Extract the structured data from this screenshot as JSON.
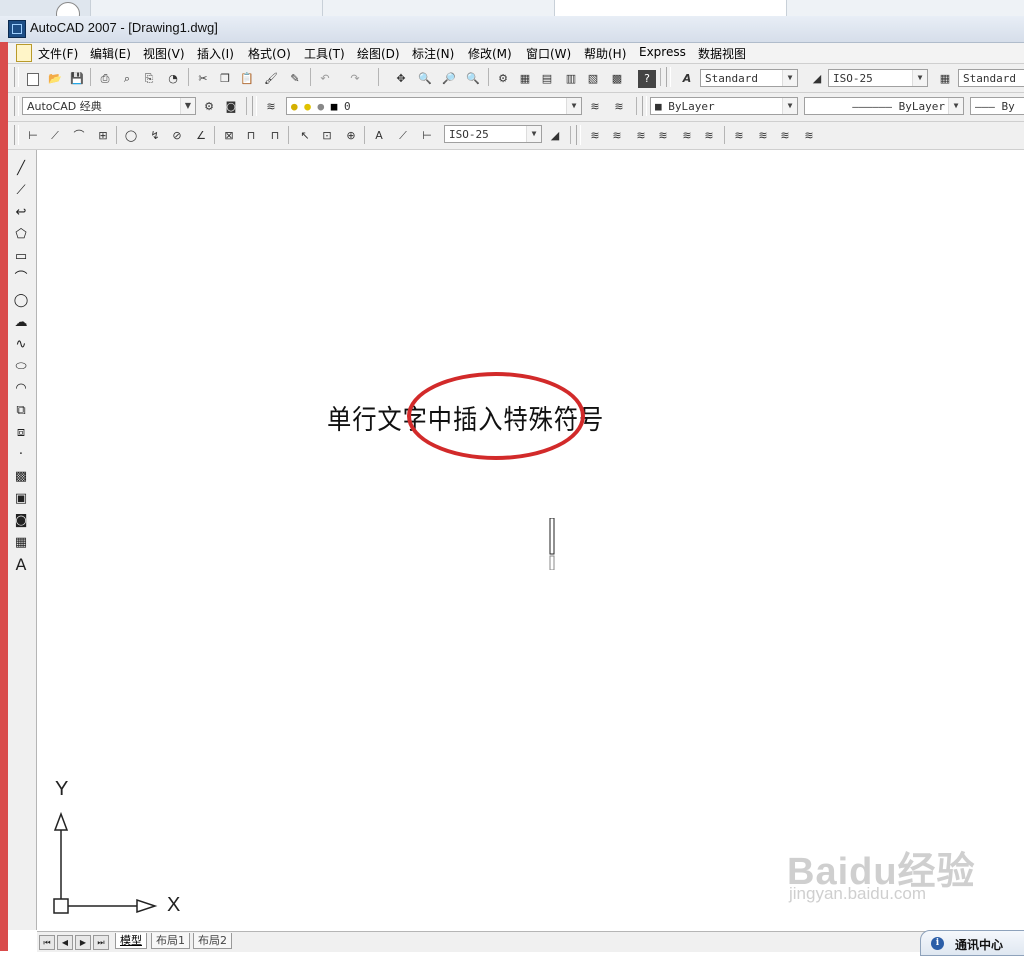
{
  "window": {
    "title": "AutoCAD 2007 - [Drawing1.dwg]"
  },
  "menu": {
    "items": [
      "文件(F)",
      "编辑(E)",
      "视图(V)",
      "插入(I)",
      "格式(O)",
      "工具(T)",
      "绘图(D)",
      "标注(N)",
      "修改(M)",
      "窗口(W)",
      "帮助(H)",
      "Express",
      "数据视图"
    ]
  },
  "toolbars": {
    "text_style": "Standard",
    "dim_style": "ISO-25",
    "table_style": "Standard",
    "workspace": "AutoCAD 经典",
    "layer": "0",
    "color": "ByLayer",
    "linetype": "ByLayer",
    "lineweight": "By",
    "dim_style_combo": "ISO-25"
  },
  "drawing": {
    "text": "单行文字中插入特殊符号",
    "ucs_x": "X",
    "ucs_y": "Y"
  },
  "layout_tabs": [
    "模型",
    "布局1",
    "布局2"
  ],
  "status": {
    "comm_center": "通讯中心"
  },
  "watermark": {
    "brand": "Baidu经验",
    "url": "jingyan.baidu.com"
  },
  "colors": {
    "highlight": "#d22a2a",
    "accent_left_bar": "#d94b4b"
  }
}
